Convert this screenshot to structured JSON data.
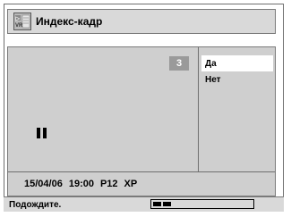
{
  "header": {
    "title": "Индекс-кадр",
    "icon": "index-frame-icon"
  },
  "preview": {
    "index_number": "3",
    "state_icon": "pause-icon"
  },
  "menu": {
    "items": [
      {
        "label": "Да",
        "selected": true
      },
      {
        "label": "Нет",
        "selected": false
      }
    ]
  },
  "info": {
    "date": "15/04/06",
    "time": "19:00",
    "program": "P12",
    "mode": "XP"
  },
  "status": {
    "message": "Подождите.",
    "progress_fraction": 0.18
  },
  "colors": {
    "panel": "#cfcfcf",
    "header": "#d9d9d9",
    "badge": "#9a9a9a",
    "selection": "#ffffff"
  }
}
